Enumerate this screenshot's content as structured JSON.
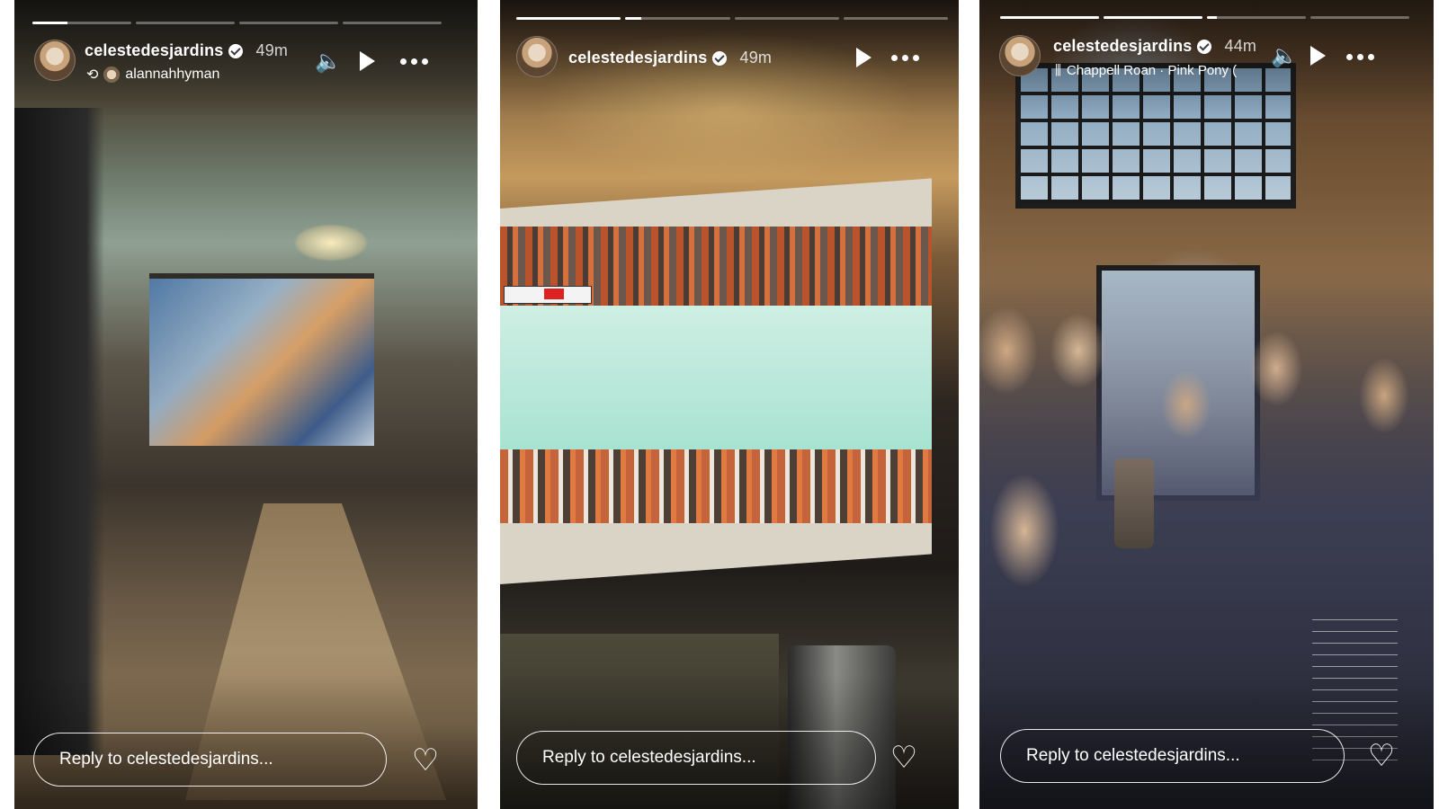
{
  "stories": [
    {
      "username": "celestedesjardins",
      "time": "49m",
      "reshare_icon": "repost-icon",
      "reshared_from": "alannahhyman",
      "reply_placeholder": "Reply to celestedesjardins...",
      "progress": [
        0.35,
        0,
        0,
        0
      ]
    },
    {
      "username": "celestedesjardins",
      "time": "49m",
      "reply_placeholder": "Reply to celestedesjardins...",
      "progress": [
        1,
        0.15,
        0,
        0
      ]
    },
    {
      "username": "celestedesjardins",
      "time": "44m",
      "music_icon": "music-bars-icon",
      "music": "Chappell Roan · Pink Pony (",
      "reply_placeholder": "Reply to celestedesjardins...",
      "progress": [
        1,
        1,
        0.1,
        0
      ]
    }
  ],
  "icons": {
    "sound": "speaker-icon",
    "play": "play-icon",
    "more": "more-options-icon",
    "like": "heart-icon",
    "verified": "verified-badge-icon"
  },
  "glyphs": {
    "repost": "⟲",
    "music": "⫼",
    "sound": "🔈",
    "heart": "♡"
  }
}
